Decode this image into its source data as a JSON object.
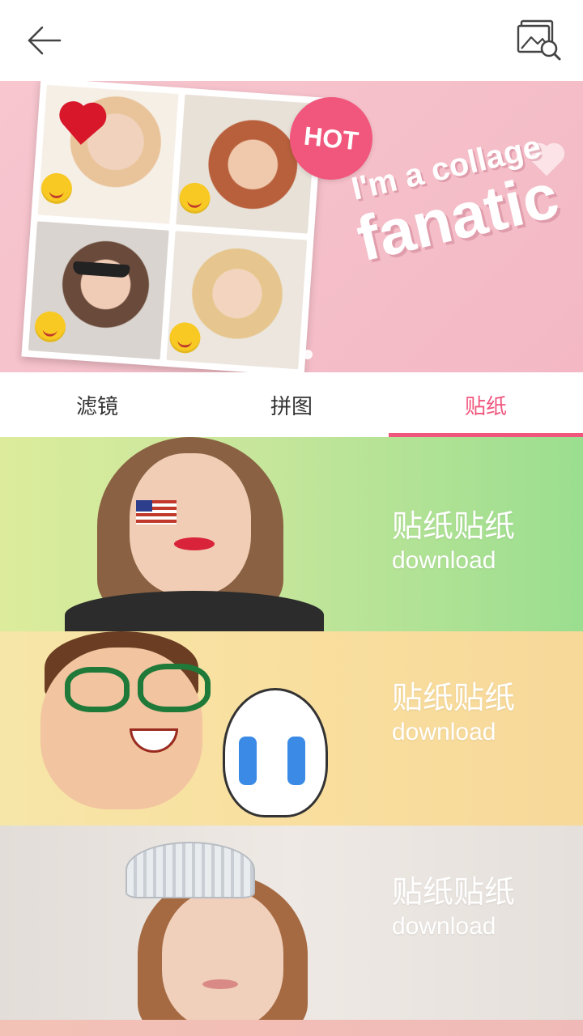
{
  "topbar": {
    "back_icon": "arrow-left-icon",
    "gallery_icon": "image-search-icon"
  },
  "banner": {
    "badge": "HOT",
    "tagline_line1": "I'm a collage",
    "tagline_line2": "fanatic"
  },
  "tabs": [
    {
      "label": "滤镜",
      "active": false
    },
    {
      "label": "拼图",
      "active": false
    },
    {
      "label": "贴纸",
      "active": true
    }
  ],
  "cards": [
    {
      "title": "贴纸贴纸",
      "subtitle": "download"
    },
    {
      "title": "贴纸贴纸",
      "subtitle": "download"
    },
    {
      "title": "贴纸贴纸",
      "subtitle": "download"
    }
  ],
  "colors": {
    "accent": "#f0567d",
    "tab_text": "#333333",
    "banner_bg": "#f5bfc9"
  }
}
